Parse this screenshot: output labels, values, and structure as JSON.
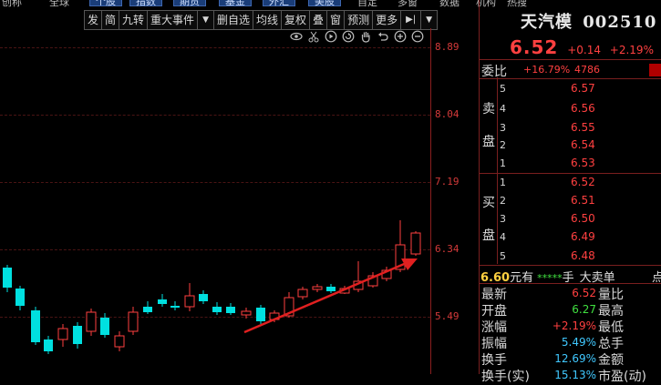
{
  "topmenu": {
    "items": [
      "创称",
      "全球",
      "个股",
      "指数",
      "期货",
      "基金",
      "外汇",
      "美股",
      "自定",
      "多窗",
      "数据",
      "机构",
      "热搜"
    ]
  },
  "toolbar": {
    "items": [
      "发",
      "简",
      "九转",
      "重大事件",
      "▼",
      "删自选",
      "均线",
      "复权",
      "叠",
      "窗",
      "预测",
      "更多",
      "▶|",
      "▼"
    ]
  },
  "chart_icons": [
    "eye-icon",
    "scissors-icon",
    "play-icon",
    "refresh-icon",
    "hand-icon",
    "undo-icon",
    "zoom-in-icon",
    "zoom-out-icon"
  ],
  "y_ticks": [
    "8.89",
    "8.04",
    "7.19",
    "6.34",
    "5.49"
  ],
  "stock": {
    "name": "天汽模",
    "code": "002510",
    "price": "6.52",
    "change": "+0.14",
    "pct": "+2.19%"
  },
  "weibi": {
    "label": "委比",
    "value": "+16.79%",
    "diff": "4786"
  },
  "sell": {
    "label_top": "卖",
    "label_bottom": "盘",
    "levels": [
      {
        "n": "5",
        "p": "6.57"
      },
      {
        "n": "4",
        "p": "6.56"
      },
      {
        "n": "3",
        "p": "6.55"
      },
      {
        "n": "2",
        "p": "6.54"
      },
      {
        "n": "1",
        "p": "6.53"
      }
    ]
  },
  "buy": {
    "label_top": "买",
    "label_bottom": "盘",
    "levels": [
      {
        "n": "1",
        "p": "6.52"
      },
      {
        "n": "2",
        "p": "6.51"
      },
      {
        "n": "3",
        "p": "6.50"
      },
      {
        "n": "4",
        "p": "6.49"
      },
      {
        "n": "5",
        "p": "6.48"
      }
    ]
  },
  "big_order": {
    "price": "6.60",
    "unit": "元有",
    "stars": "*****",
    "hand": "手",
    "type": "大卖单",
    "dot": "点"
  },
  "stats": [
    {
      "l": "最新",
      "v": "6.52",
      "r": "量比",
      "color": "#ff4040"
    },
    {
      "l": "开盘",
      "v": "6.27",
      "r": "最高",
      "color": "#40e040"
    },
    {
      "l": "涨幅",
      "v": "+2.19%",
      "r": "最低",
      "color": "#ff4040"
    },
    {
      "l": "振幅",
      "v": "5.49%",
      "r": "总手",
      "color": "#40c8ff"
    },
    {
      "l": "换手",
      "v": "12.69%",
      "r": "金额",
      "color": "#40c8ff"
    },
    {
      "l": "换手(实)",
      "v": "15.13%",
      "r": "市盈(动)",
      "color": "#40c8ff"
    }
  ],
  "colors": {
    "up": "#ff4040",
    "down": "#00e0e0",
    "grid": "#4a1414",
    "arrow": "#e02020"
  }
}
